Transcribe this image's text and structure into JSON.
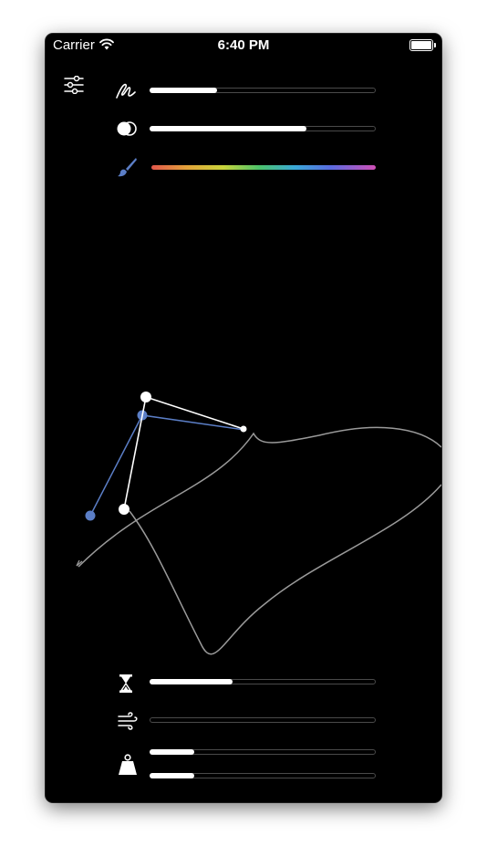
{
  "status_bar": {
    "carrier": "Carrier",
    "time": "6:40 PM",
    "battery_level": 1.0
  },
  "top_controls": {
    "settings_icon": "sliders-icon",
    "stroke": {
      "icon": "scribble-icon",
      "value": 0.3
    },
    "opacity": {
      "icon": "overlapping-circles-icon",
      "value": 0.7
    },
    "color": {
      "icon": "paintbrush-icon",
      "accent": "#5b7ec6",
      "gradient": [
        "#e2574c",
        "#e3a33a",
        "#c9d43b",
        "#4cc36a",
        "#3aa8d8",
        "#5a6be0",
        "#d04fb6"
      ]
    }
  },
  "bottom_controls": {
    "duration": {
      "icon": "hourglass-icon",
      "value": 0.37
    },
    "wind": {
      "icon": "wind-icon",
      "value": 0.0
    },
    "weight": {
      "icon": "weight-icon",
      "value_a": 0.2,
      "value_b": 0.2
    }
  },
  "colors": {
    "background": "#000000",
    "foreground": "#ffffff",
    "handle_blue": "#5b7ec6",
    "curve": "#9a9a9a",
    "track_border": "#4a4a4a"
  }
}
